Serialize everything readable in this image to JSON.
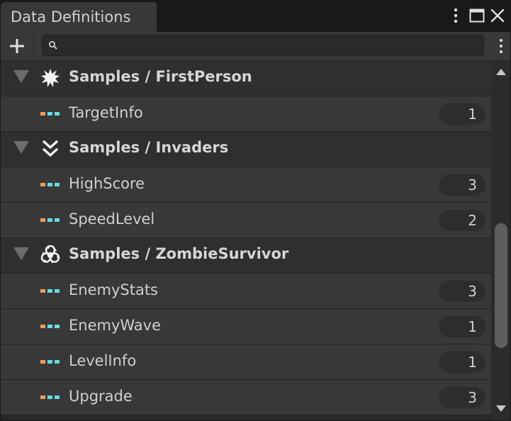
{
  "window": {
    "title": "Data Definitions"
  },
  "icons": {
    "menu": "kebab-menu-icon",
    "maximize": "maximize-icon",
    "close": "close-icon",
    "add": "plus-icon",
    "search": "magnifier-icon"
  },
  "search": {
    "value": "",
    "placeholder": ""
  },
  "colors": {
    "type_icon_orange": "#f39a5a",
    "type_icon_cyan": "#66dbe8",
    "badge_bg": "#2d2d2d"
  },
  "groups": [
    {
      "label": "Samples / FirstPerson",
      "icon": "explosion-icon",
      "items": [
        {
          "label": "TargetInfo",
          "count": "1"
        }
      ]
    },
    {
      "label": "Samples / Invaders",
      "icon": "double-chevron-down-icon",
      "items": [
        {
          "label": "HighScore",
          "count": "3"
        },
        {
          "label": "SpeedLevel",
          "count": "2"
        }
      ]
    },
    {
      "label": "Samples / ZombieSurvivor",
      "icon": "biohazard-icon",
      "items": [
        {
          "label": "EnemyStats",
          "count": "3"
        },
        {
          "label": "EnemyWave",
          "count": "1"
        },
        {
          "label": "LevelInfo",
          "count": "1"
        },
        {
          "label": "Upgrade",
          "count": "3"
        }
      ]
    }
  ]
}
